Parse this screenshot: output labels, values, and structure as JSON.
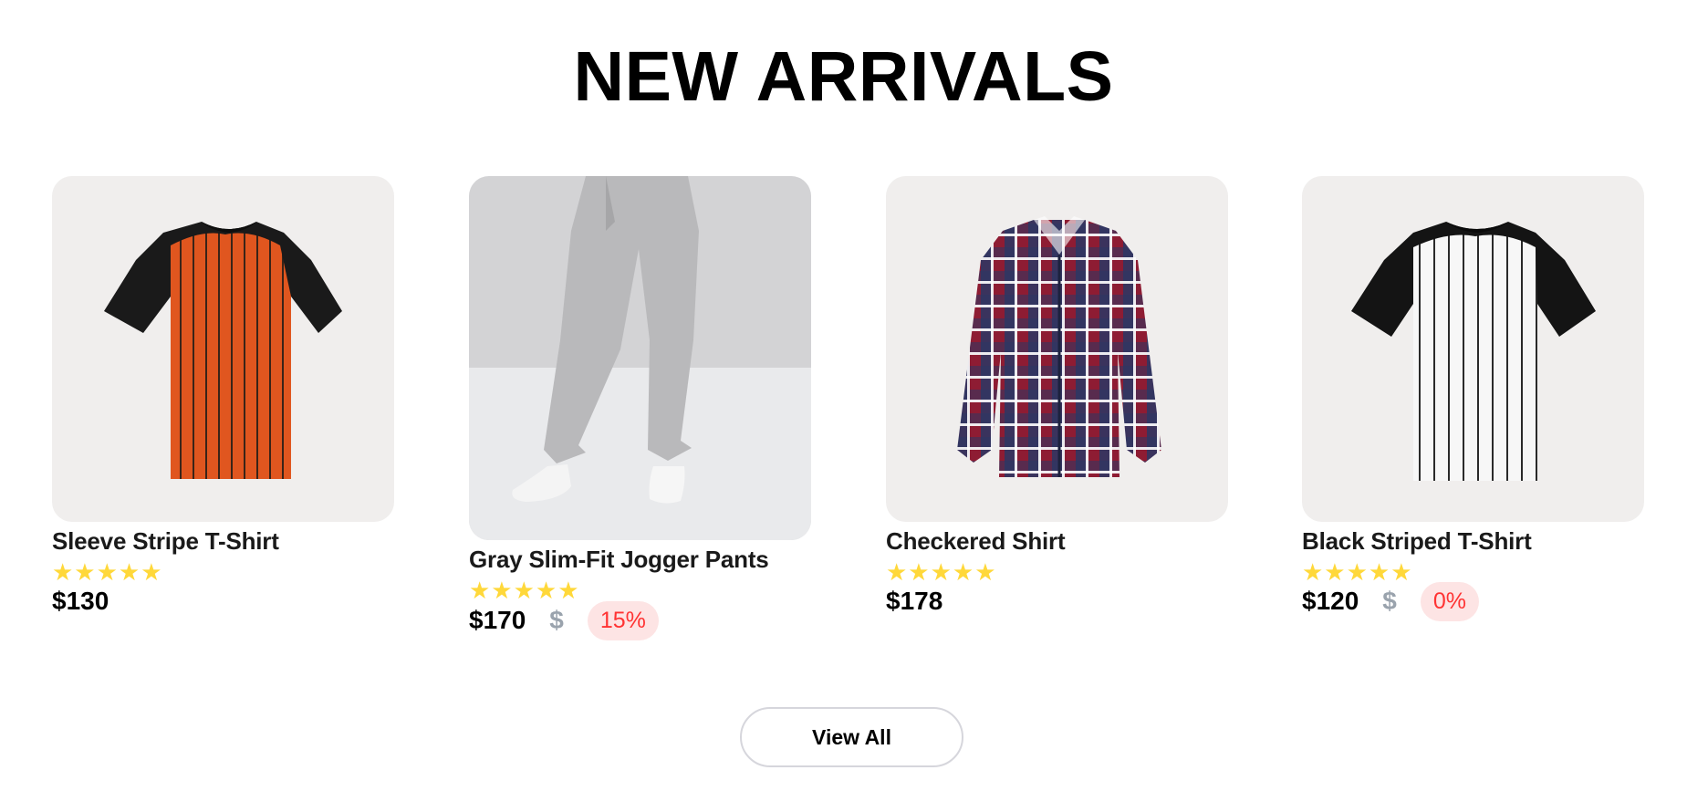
{
  "section": {
    "title": "NEW ARRIVALS"
  },
  "colors": {
    "star": "#ffd83a",
    "discount_text": "#ff3333",
    "discount_bg": "#fde4e4",
    "old_price": "#9aa3ad",
    "card_bg": "#f0eeed"
  },
  "products": [
    {
      "name": "Sleeve Stripe T-Shirt",
      "rating_stars": "★★★★★",
      "rating": 5,
      "price": "$130",
      "image": "orange-striped-raglan-tshirt"
    },
    {
      "name": "Gray Slim-Fit Jogger Pants",
      "rating_stars": "★★★★★",
      "rating": 5,
      "price": "$170",
      "old_price": "$",
      "discount": "15%",
      "image": "gray-jogger-pants"
    },
    {
      "name": "Checkered Shirt",
      "rating_stars": "★★★★★",
      "rating": 5,
      "price": "$178",
      "image": "red-navy-plaid-shirt"
    },
    {
      "name": "Black Striped T-Shirt",
      "rating_stars": "★★★★★",
      "rating": 5,
      "price": "$120",
      "old_price": "$",
      "discount": "0%",
      "image": "white-pinstripe-raglan-tshirt"
    }
  ],
  "actions": {
    "view_all_label": "View All"
  }
}
